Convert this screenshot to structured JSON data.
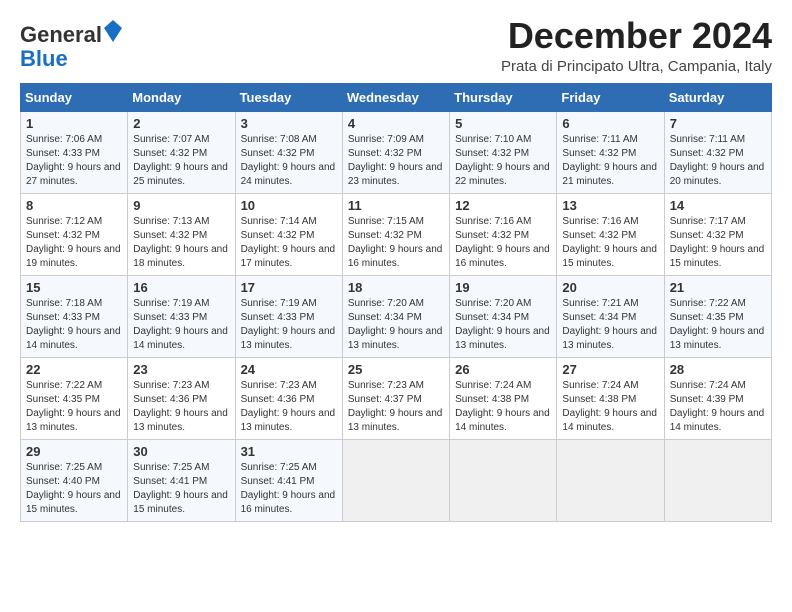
{
  "logo": {
    "line1": "General",
    "line2": "Blue"
  },
  "title": "December 2024",
  "location": "Prata di Principato Ultra, Campania, Italy",
  "days_of_week": [
    "Sunday",
    "Monday",
    "Tuesday",
    "Wednesday",
    "Thursday",
    "Friday",
    "Saturday"
  ],
  "weeks": [
    [
      {
        "day": 1,
        "sunrise": "7:06 AM",
        "sunset": "4:33 PM",
        "daylight": "9 hours and 27 minutes."
      },
      {
        "day": 2,
        "sunrise": "7:07 AM",
        "sunset": "4:32 PM",
        "daylight": "9 hours and 25 minutes."
      },
      {
        "day": 3,
        "sunrise": "7:08 AM",
        "sunset": "4:32 PM",
        "daylight": "9 hours and 24 minutes."
      },
      {
        "day": 4,
        "sunrise": "7:09 AM",
        "sunset": "4:32 PM",
        "daylight": "9 hours and 23 minutes."
      },
      {
        "day": 5,
        "sunrise": "7:10 AM",
        "sunset": "4:32 PM",
        "daylight": "9 hours and 22 minutes."
      },
      {
        "day": 6,
        "sunrise": "7:11 AM",
        "sunset": "4:32 PM",
        "daylight": "9 hours and 21 minutes."
      },
      {
        "day": 7,
        "sunrise": "7:11 AM",
        "sunset": "4:32 PM",
        "daylight": "9 hours and 20 minutes."
      }
    ],
    [
      {
        "day": 8,
        "sunrise": "7:12 AM",
        "sunset": "4:32 PM",
        "daylight": "9 hours and 19 minutes."
      },
      {
        "day": 9,
        "sunrise": "7:13 AM",
        "sunset": "4:32 PM",
        "daylight": "9 hours and 18 minutes."
      },
      {
        "day": 10,
        "sunrise": "7:14 AM",
        "sunset": "4:32 PM",
        "daylight": "9 hours and 17 minutes."
      },
      {
        "day": 11,
        "sunrise": "7:15 AM",
        "sunset": "4:32 PM",
        "daylight": "9 hours and 16 minutes."
      },
      {
        "day": 12,
        "sunrise": "7:16 AM",
        "sunset": "4:32 PM",
        "daylight": "9 hours and 16 minutes."
      },
      {
        "day": 13,
        "sunrise": "7:16 AM",
        "sunset": "4:32 PM",
        "daylight": "9 hours and 15 minutes."
      },
      {
        "day": 14,
        "sunrise": "7:17 AM",
        "sunset": "4:32 PM",
        "daylight": "9 hours and 15 minutes."
      }
    ],
    [
      {
        "day": 15,
        "sunrise": "7:18 AM",
        "sunset": "4:33 PM",
        "daylight": "9 hours and 14 minutes."
      },
      {
        "day": 16,
        "sunrise": "7:19 AM",
        "sunset": "4:33 PM",
        "daylight": "9 hours and 14 minutes."
      },
      {
        "day": 17,
        "sunrise": "7:19 AM",
        "sunset": "4:33 PM",
        "daylight": "9 hours and 13 minutes."
      },
      {
        "day": 18,
        "sunrise": "7:20 AM",
        "sunset": "4:34 PM",
        "daylight": "9 hours and 13 minutes."
      },
      {
        "day": 19,
        "sunrise": "7:20 AM",
        "sunset": "4:34 PM",
        "daylight": "9 hours and 13 minutes."
      },
      {
        "day": 20,
        "sunrise": "7:21 AM",
        "sunset": "4:34 PM",
        "daylight": "9 hours and 13 minutes."
      },
      {
        "day": 21,
        "sunrise": "7:22 AM",
        "sunset": "4:35 PM",
        "daylight": "9 hours and 13 minutes."
      }
    ],
    [
      {
        "day": 22,
        "sunrise": "7:22 AM",
        "sunset": "4:35 PM",
        "daylight": "9 hours and 13 minutes."
      },
      {
        "day": 23,
        "sunrise": "7:23 AM",
        "sunset": "4:36 PM",
        "daylight": "9 hours and 13 minutes."
      },
      {
        "day": 24,
        "sunrise": "7:23 AM",
        "sunset": "4:36 PM",
        "daylight": "9 hours and 13 minutes."
      },
      {
        "day": 25,
        "sunrise": "7:23 AM",
        "sunset": "4:37 PM",
        "daylight": "9 hours and 13 minutes."
      },
      {
        "day": 26,
        "sunrise": "7:24 AM",
        "sunset": "4:38 PM",
        "daylight": "9 hours and 14 minutes."
      },
      {
        "day": 27,
        "sunrise": "7:24 AM",
        "sunset": "4:38 PM",
        "daylight": "9 hours and 14 minutes."
      },
      {
        "day": 28,
        "sunrise": "7:24 AM",
        "sunset": "4:39 PM",
        "daylight": "9 hours and 14 minutes."
      }
    ],
    [
      {
        "day": 29,
        "sunrise": "7:25 AM",
        "sunset": "4:40 PM",
        "daylight": "9 hours and 15 minutes."
      },
      {
        "day": 30,
        "sunrise": "7:25 AM",
        "sunset": "4:41 PM",
        "daylight": "9 hours and 15 minutes."
      },
      {
        "day": 31,
        "sunrise": "7:25 AM",
        "sunset": "4:41 PM",
        "daylight": "9 hours and 16 minutes."
      },
      null,
      null,
      null,
      null
    ]
  ],
  "labels": {
    "sunrise": "Sunrise:",
    "sunset": "Sunset:",
    "daylight": "Daylight:"
  }
}
